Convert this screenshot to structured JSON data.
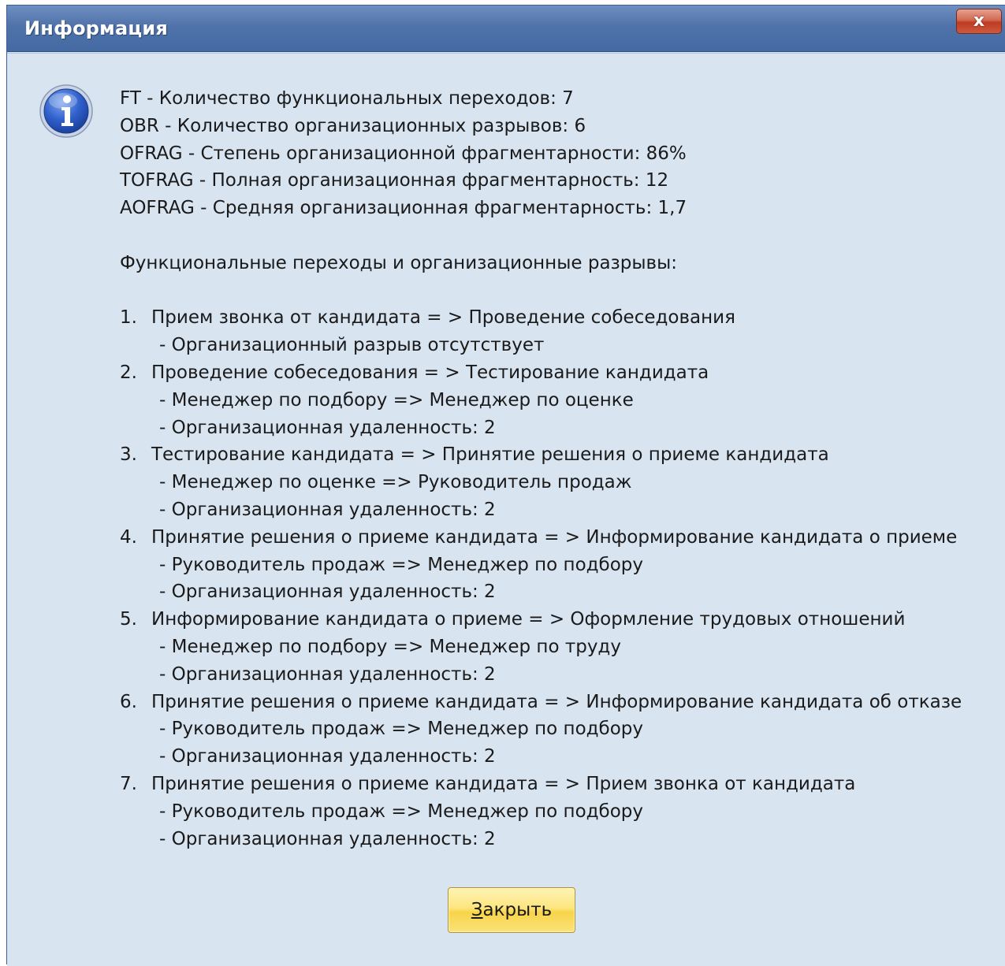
{
  "window": {
    "title": "Информация",
    "close_glyph": "x"
  },
  "icon": "info-icon",
  "summary": [
    "FT - Количество функциональных переходов: 7",
    "OBR - Количество организационных разрывов: 6",
    "OFRAG - Степень организационной фрагментарности: 86%",
    "TOFRAG - Полная организационная фрагментарность: 12",
    "AOFRAG - Средняя организационная фрагментарность: 1,7"
  ],
  "section_heading": "Функциональные переходы и организационные разрывы:",
  "transitions": [
    {
      "num": "1.",
      "text": "Прием звонка от кандидата = > Проведение собеседования",
      "details": [
        "- Организационный разрыв отсутствует"
      ]
    },
    {
      "num": "2.",
      "text": "Проведение собеседования = > Тестирование кандидата",
      "details": [
        "- Менеджер по подбору => Менеджер по оценке",
        "- Организационная удаленность: 2"
      ]
    },
    {
      "num": "3.",
      "text": "Тестирование кандидата = > Принятие решения о приеме кандидата",
      "details": [
        "- Менеджер по оценке => Руководитель продаж",
        "- Организационная удаленность: 2"
      ]
    },
    {
      "num": "4.",
      "text": "Принятие решения о приеме кандидата = > Информирование кандидата о приеме",
      "details": [
        "- Руководитель продаж => Менеджер по подбору",
        "- Организационная удаленность: 2"
      ]
    },
    {
      "num": "5.",
      "text": "Информирование кандидата о приеме = > Оформление трудовых отношений",
      "details": [
        "- Менеджер по подбору => Менеджер по труду",
        "- Организационная удаленность: 2"
      ]
    },
    {
      "num": "6.",
      "text": "Принятие решения о приеме кандидата = > Информирование кандидата об отказе",
      "details": [
        "- Руководитель продаж => Менеджер по подбору",
        "- Организационная удаленность: 2"
      ]
    },
    {
      "num": "7.",
      "text": "Принятие решения о приеме кандидата = > Прием звонка от кандидата",
      "details": [
        "- Руководитель продаж => Менеджер по подбору",
        "- Организационная удаленность: 2"
      ]
    }
  ],
  "buttons": {
    "close_access_key": "З",
    "close_rest": "акрыть"
  },
  "colors": {
    "title_bar": "#4f72aa",
    "dialog_bg": "#d9e4f1",
    "close_x": "#c4452b",
    "button_yellow": "#fde680"
  }
}
